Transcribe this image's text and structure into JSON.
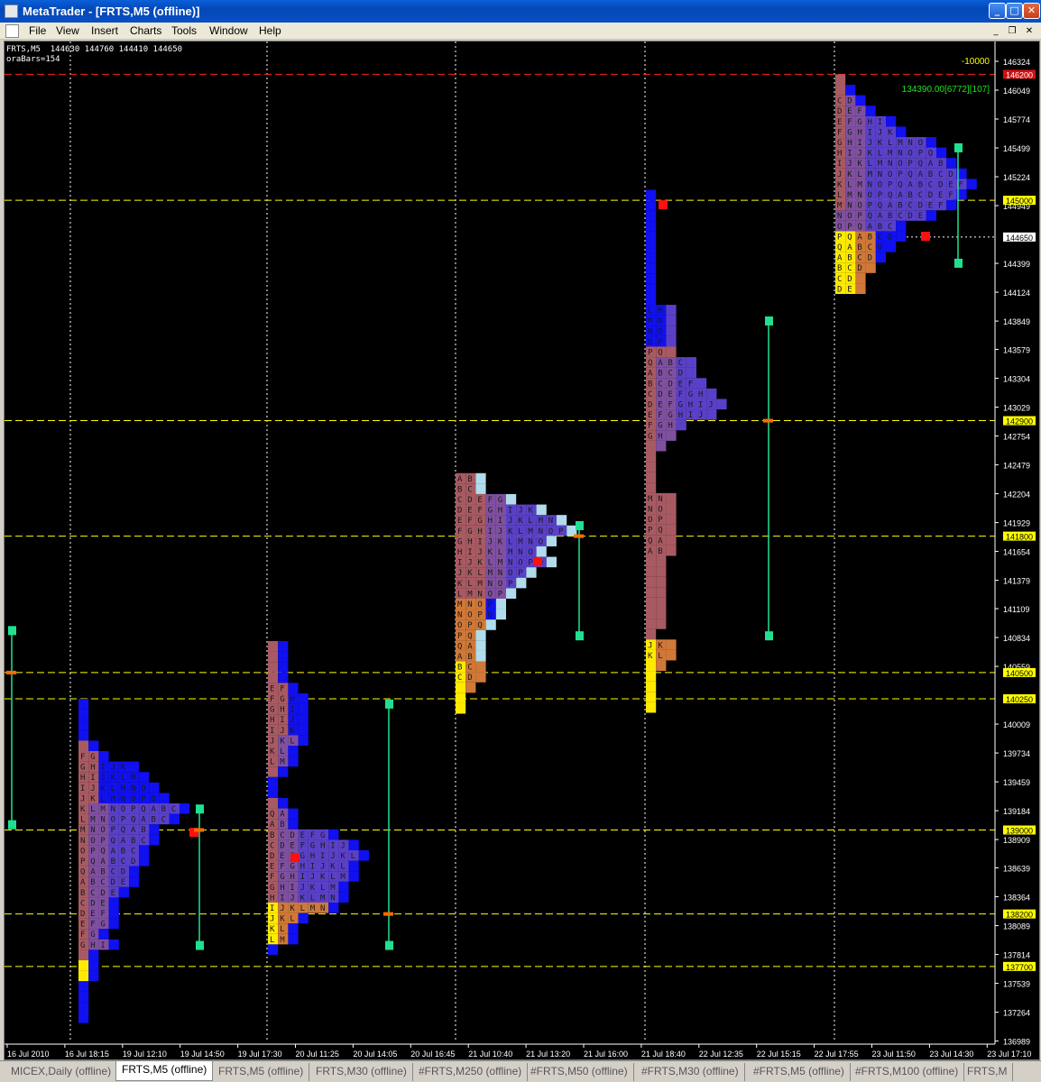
{
  "window": {
    "title": "MetaTrader - [FRTS,M5 (offline)]"
  },
  "menu": [
    "File",
    "View",
    "Insert",
    "Charts",
    "Tools",
    "Window",
    "Help"
  ],
  "chart_info": {
    "line1": "FRTS,M5  144630 144760 144410 144650",
    "line2": "oraBars=154"
  },
  "top_label": "-10000",
  "stat_label": "134390.00[6772][107]",
  "price_axis": {
    "ticks": [
      "146324",
      "146049",
      "145774",
      "145499",
      "145224",
      "144949",
      "144399",
      "144124",
      "143849",
      "143579",
      "143304",
      "143029",
      "142754",
      "142479",
      "142204",
      "141929",
      "141654",
      "141379",
      "141109",
      "140834",
      "140559",
      "140009",
      "139734",
      "139459",
      "139184",
      "138909",
      "138639",
      "138364",
      "138089",
      "137814",
      "137539",
      "137264",
      "136989"
    ],
    "tags": [
      {
        "label": "146200",
        "color": "#d01010"
      },
      {
        "label": "145000",
        "color": "#ffff00"
      },
      {
        "label": "144650",
        "color": "#ffffff"
      },
      {
        "label": "142900",
        "color": "#ffff00"
      },
      {
        "label": "141800",
        "color": "#ffff00"
      },
      {
        "label": "140500",
        "color": "#ffff00"
      },
      {
        "label": "140250",
        "color": "#ffff00"
      },
      {
        "label": "139000",
        "color": "#ffff00"
      },
      {
        "label": "138200",
        "color": "#ffff00"
      },
      {
        "label": "137700",
        "color": "#ffff00"
      }
    ]
  },
  "time_axis": [
    "16 Jul 2010",
    "16 Jul 18:15",
    "19 Jul 12:10",
    "19 Jul 14:50",
    "19 Jul 17:30",
    "20 Jul 11:25",
    "20 Jul 14:05",
    "20 Jul 16:45",
    "21 Jul 10:40",
    "21 Jul 13:20",
    "21 Jul 16:00",
    "21 Jul 18:40",
    "22 Jul 12:35",
    "22 Jul 15:15",
    "22 Jul 17:55",
    "23 Jul 11:50",
    "23 Jul 14:30",
    "23 Jul 17:10"
  ],
  "tabs": [
    "MICEX,Daily (offline)",
    "FRTS,M5 (offline)",
    "FRTS,M5 (offline)",
    "FRTS,M30 (offline)",
    "#FRTS,M250 (offline)",
    "#FRTS,M50 (offline)",
    "#FRTS,M30 (offline)",
    "#FRTS,M5 (offline)",
    "#FRTS,M100 (offline)",
    "FRTS,M"
  ],
  "active_tab": 1,
  "colors": {
    "bg": "#000000",
    "grid": "#ffffff",
    "level": "#ffff00",
    "top_line": "#ff2020",
    "yellow": "#ffea00",
    "orange": "#d07838",
    "brown": "#a85a62",
    "purple": "#8050a0",
    "indigo": "#5a40c8",
    "blue": "#1010f0",
    "lightblue": "#b0dcec",
    "teal": "#20e090"
  }
}
